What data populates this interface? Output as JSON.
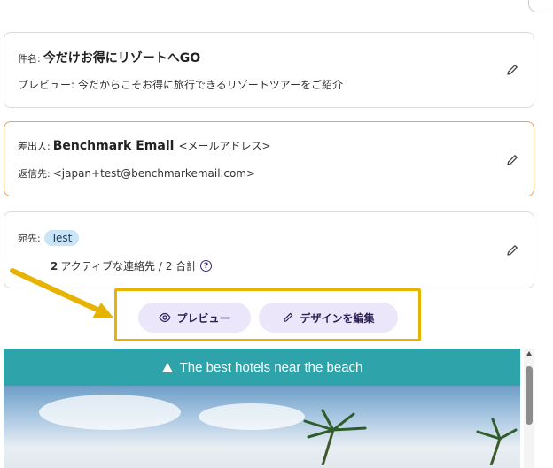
{
  "subject": {
    "label": "件名:",
    "value": "今だけお得にリゾートへGO",
    "preview_label": "プレビュー:",
    "preview_text": "今だからこそお得に旅行できるリゾートツアーをご紹介"
  },
  "sender": {
    "from_label": "差出人:",
    "from_name": "Benchmark Email",
    "from_address": "<メールアドレス>",
    "reply_label": "返信先:",
    "reply_address": "<japan+test@benchmarkemail.com>"
  },
  "recipient": {
    "label": "宛先:",
    "tag": "Test",
    "active_count": "2",
    "active_text": "アクティブな連絡先 / 2 合計"
  },
  "actions": {
    "preview_label": "プレビュー",
    "design_label": "デザインを編集"
  },
  "email_preview": {
    "banner_text": "The best hotels near the beach"
  },
  "colors": {
    "highlight": "#e6b400",
    "banner": "#2fa3aa",
    "pill_bg": "#ece6fb",
    "sender_border": "#e8a060"
  }
}
